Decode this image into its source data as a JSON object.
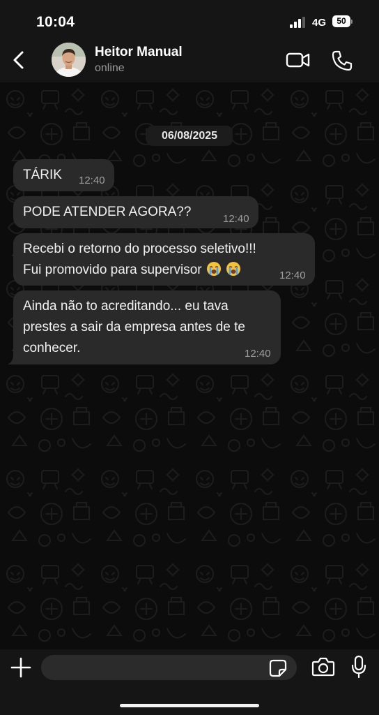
{
  "status_bar": {
    "time": "10:04",
    "network": "4G",
    "battery": "50"
  },
  "header": {
    "contact_name": "Heitor Manual",
    "contact_status": "online",
    "icons": [
      "back-arrow-icon",
      "avatar",
      "video-camera-icon",
      "phone-icon"
    ]
  },
  "chat": {
    "date": "06/08/2025",
    "messages": [
      {
        "lines": [
          "TÁRIK"
        ],
        "time": "12:40"
      },
      {
        "lines": [
          "PODE ATENDER AGORA??"
        ],
        "time": "12:40"
      },
      {
        "lines": [
          "Recebi o retorno do processo seletivo!!!",
          "Fui promovido para supervisor"
        ],
        "emojis": [
          "loudly-crying-face",
          "loudly-crying-face"
        ],
        "time": "12:40"
      },
      {
        "lines": [
          "Ainda não to acreditando... eu tava",
          "prestes a sair da empresa antes de te",
          "conhecer."
        ],
        "time": "12:40"
      }
    ]
  },
  "input_bar": {
    "placeholder": "",
    "icons": [
      "plus-icon",
      "sticker-icon",
      "camera-icon",
      "microphone-icon"
    ]
  },
  "colors": {
    "background": "#0c0c0c",
    "bar": "#151515",
    "bubble": "#2a2a2a",
    "text": "#f1f1f1",
    "timestamp": "#9e9e9e"
  }
}
